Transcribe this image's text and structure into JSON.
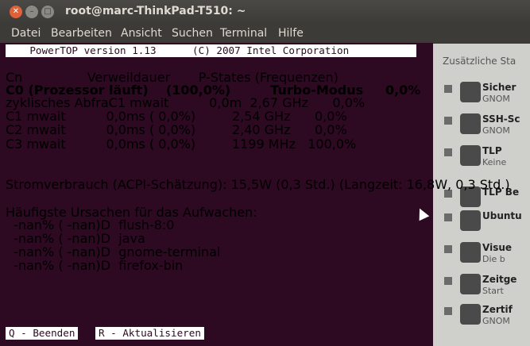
{
  "window": {
    "title": "root@marc-ThinkPad-T510: ~"
  },
  "menu": [
    "Datei",
    "Bearbeiten",
    "Ansicht",
    "Suchen",
    "Terminal",
    "Hilfe"
  ],
  "terminal": {
    "header": "    PowerTOP version 1.13      (C) 2007 Intel Corporation",
    "lines": [
      "Cn                Verweildauer       P-States (Frequenzen)",
      "C0 (Prozessor läuft)    (100,0%)         Turbo-Modus     0,0%",
      "zyklisches AbfraC1 mwait          0,0m  2,67 GHz      0,0%",
      "C1 mwait          0,0ms ( 0,0%)         2,54 GHz      0,0%",
      "C2 mwait          0,0ms ( 0,0%)         2,40 GHz      0,0%",
      "C3 mwait          0,0ms ( 0,0%)         1199 MHz   100,0%",
      "",
      "",
      "Stromverbrauch (ACPI-Schätzung): 15,5W (0,3 Std.) (Langzeit: 16,8W, 0,3 Std.)",
      "",
      "Häufigste Ursachen für das Aufwachen:",
      "  -nan% ( -nan)D  flush-8:0",
      "  -nan% ( -nan)D  java",
      "  -nan% ( -nan)D  gnome-terminal",
      "  -nan% ( -nan)D  firefox-bin"
    ],
    "keys": {
      "quit": "Q - Beenden",
      "refresh": "R - Aktualisieren"
    }
  },
  "background_app": {
    "heading": "Zusätzliche Sta",
    "items": [
      {
        "title": "Sicher",
        "subtitle": "GNOM"
      },
      {
        "title": "SSH-Sc",
        "subtitle": "GNOM"
      },
      {
        "title": "TLP",
        "subtitle": "Keine"
      },
      {
        "title": "TLP Be",
        "subtitle": ""
      },
      {
        "title": "Ubuntu",
        "subtitle": ""
      },
      {
        "title": "Visue",
        "subtitle": "Die b"
      },
      {
        "title": "Zeitge",
        "subtitle": "Start"
      },
      {
        "title": "Zertif",
        "subtitle": "GNOM"
      }
    ]
  }
}
